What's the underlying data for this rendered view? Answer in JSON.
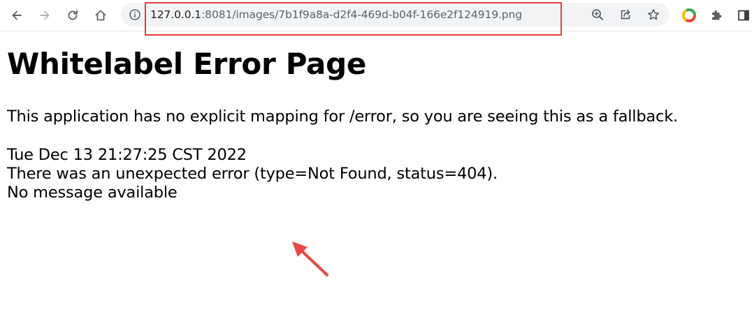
{
  "browser": {
    "url_host": "127.0.0.1",
    "url_rest": ":8081/images/7b1f9a8a-d2f4-469d-b04f-166e2f124919.png",
    "back_icon": "arrow-left-icon",
    "forward_icon": "arrow-right-icon",
    "reload_icon": "reload-icon",
    "home_icon": "home-icon",
    "site_info_icon": "info-icon",
    "zoom_icon": "zoom-icon",
    "share_icon": "share-icon",
    "bookmark_icon": "star-icon",
    "extension_icon": "puzzle-icon",
    "sidepanel_icon": "side-panel-icon",
    "highlight_color": "#e0413c"
  },
  "page": {
    "title": "Whitelabel Error Page",
    "message": "This application has no explicit mapping for /error, so you are seeing this as a fallback.",
    "timestamp": "Tue Dec 13 21:27:25 CST 2022",
    "error_line": "There was an unexpected error (type=Not Found, status=404).",
    "detail_line": "No message available"
  },
  "annotation": {
    "arrow_color": "#e94646"
  }
}
